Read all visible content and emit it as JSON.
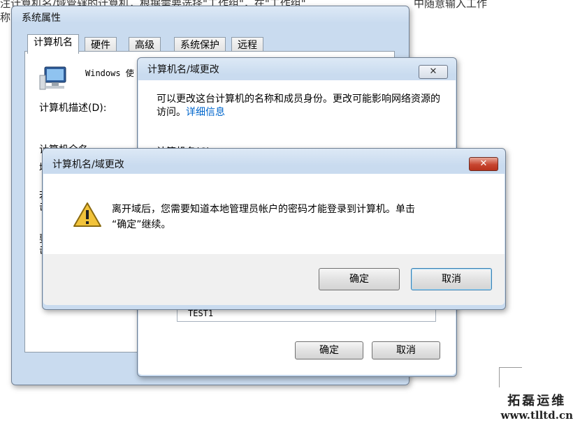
{
  "background_text": {
    "line1_left": "注计算机名/域管辖的计算机，根据需要选择\"工作组\"，在\"工作组\"",
    "line1_right": "中随意输入工作",
    "line2": "称"
  },
  "system_properties": {
    "title": "系统属性",
    "tabs": [
      "计算机名",
      "硬件",
      "高级",
      "系统保护",
      "远程"
    ],
    "windows_text": "Windows 使",
    "description_label": "计算机描述(D):",
    "fragment_label1": "计算机全名",
    "fragment_label2": "域",
    "fragment_label3": "若要",
    "fragment_label4": "击",
    "fragment_label5": "要",
    "fragment_label6": "击"
  },
  "domain_change": {
    "title": "计算机名/域更改",
    "close": "✕",
    "intro": "可以更改这台计算机的名称和成员身份。更改可能影响网络资源的访问。",
    "link": "详细信息",
    "name_label": "计算机名(C):",
    "workgroup_value": "TEST1",
    "ok": "确定",
    "cancel": "取消"
  },
  "alert": {
    "title": "计算机名/域更改",
    "close": "✕",
    "message_line1": "离开域后，您需要知道本地管理员帐户的密码才能登录到计算机。单击",
    "message_line2": "“确定”继续。",
    "ok": "确定",
    "cancel": "取消"
  },
  "watermark": {
    "brand": "拓磊运维",
    "url": "www.tlltd.cn"
  }
}
